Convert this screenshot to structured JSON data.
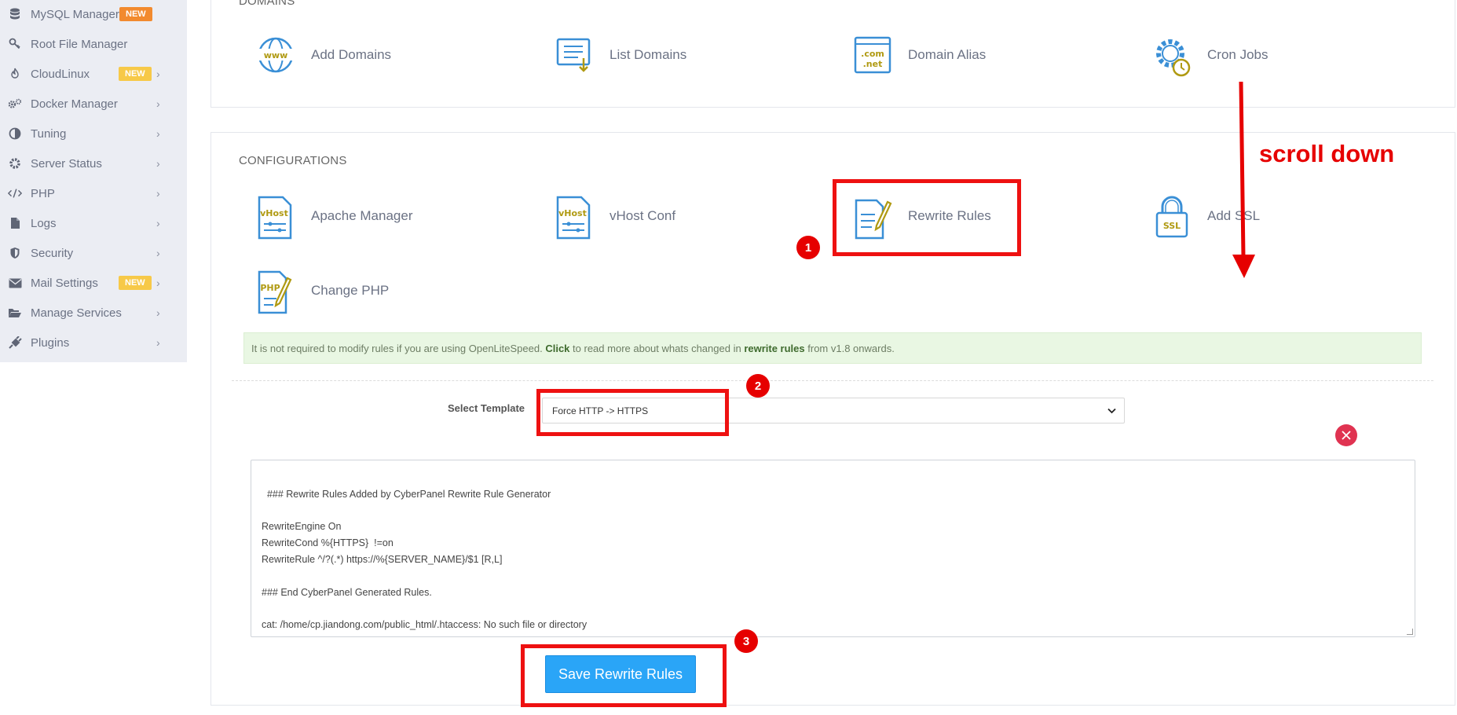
{
  "sidebar": {
    "items": [
      {
        "label": "MySQL Manager",
        "badge": "NEW",
        "icon": "database-icon"
      },
      {
        "label": "Root File Manager",
        "icon": "key-icon"
      },
      {
        "label": "CloudLinux",
        "badge": "NEW",
        "icon": "flame-icon"
      },
      {
        "label": "Docker Manager",
        "icon": "gears-icon"
      },
      {
        "label": "Tuning",
        "icon": "contrast-icon"
      },
      {
        "label": "Server Status",
        "icon": "cog-icon"
      },
      {
        "label": "PHP",
        "icon": "code-icon"
      },
      {
        "label": "Logs",
        "icon": "file-icon"
      },
      {
        "label": "Security",
        "icon": "shield-icon"
      },
      {
        "label": "Mail Settings",
        "badge": "NEW",
        "icon": "envelope-icon"
      },
      {
        "label": "Manage Services",
        "icon": "folder-open-icon"
      },
      {
        "label": "Plugins",
        "icon": "plug-icon"
      }
    ]
  },
  "domains": {
    "title": "DOMAINS",
    "tiles": [
      {
        "label": "Add Domains",
        "icon": "www-globe-icon"
      },
      {
        "label": "List Domains",
        "icon": "list-download-icon"
      },
      {
        "label": "Domain Alias",
        "icon": "com-net-icon"
      },
      {
        "label": "Cron Jobs",
        "icon": "cog-clock-icon"
      }
    ]
  },
  "configurations": {
    "title": "CONFIGURATIONS",
    "tiles": [
      {
        "label": "Apache Manager",
        "icon": "vhost-doc-icon",
        "icon_text": "vHost"
      },
      {
        "label": "vHost Conf",
        "icon": "vhost-doc-icon",
        "icon_text": "vHost"
      },
      {
        "label": "Rewrite Rules",
        "icon": "doc-pencil-icon"
      },
      {
        "label": "Add SSL",
        "icon": "ssl-lock-icon",
        "icon_text": "SSL"
      },
      {
        "label": "Change PHP",
        "icon": "php-doc-icon",
        "icon_text": "PHP"
      }
    ]
  },
  "alert": {
    "before": "It is not required to modify rules if you are using OpenLiteSpeed.",
    "link1": "Click",
    "middle": "to read more about whats changed in",
    "link2": "rewrite rules",
    "after": "from v1.8 onwards."
  },
  "template": {
    "label": "Select Template",
    "selected": "Force HTTP -> HTTPS"
  },
  "rules_text": "### Rewrite Rules Added by CyberPanel Rewrite Rule Generator\n\nRewriteEngine On\nRewriteCond %{HTTPS}  !=on\nRewriteRule ^/?(.*) https://%{SERVER_NAME}/$1 [R,L]\n\n### End CyberPanel Generated Rules.\n\ncat: /home/cp.jiandong.com/public_html/.htaccess: No such file or directory",
  "save_button": "Save Rewrite Rules",
  "annotations": {
    "scroll_text": "scroll down",
    "step1": "1",
    "step2": "2",
    "step3": "3"
  },
  "colors": {
    "accent": "#2aa5f7",
    "annotation_red": "#e60000",
    "sidebar_bg": "#ebedf3"
  }
}
